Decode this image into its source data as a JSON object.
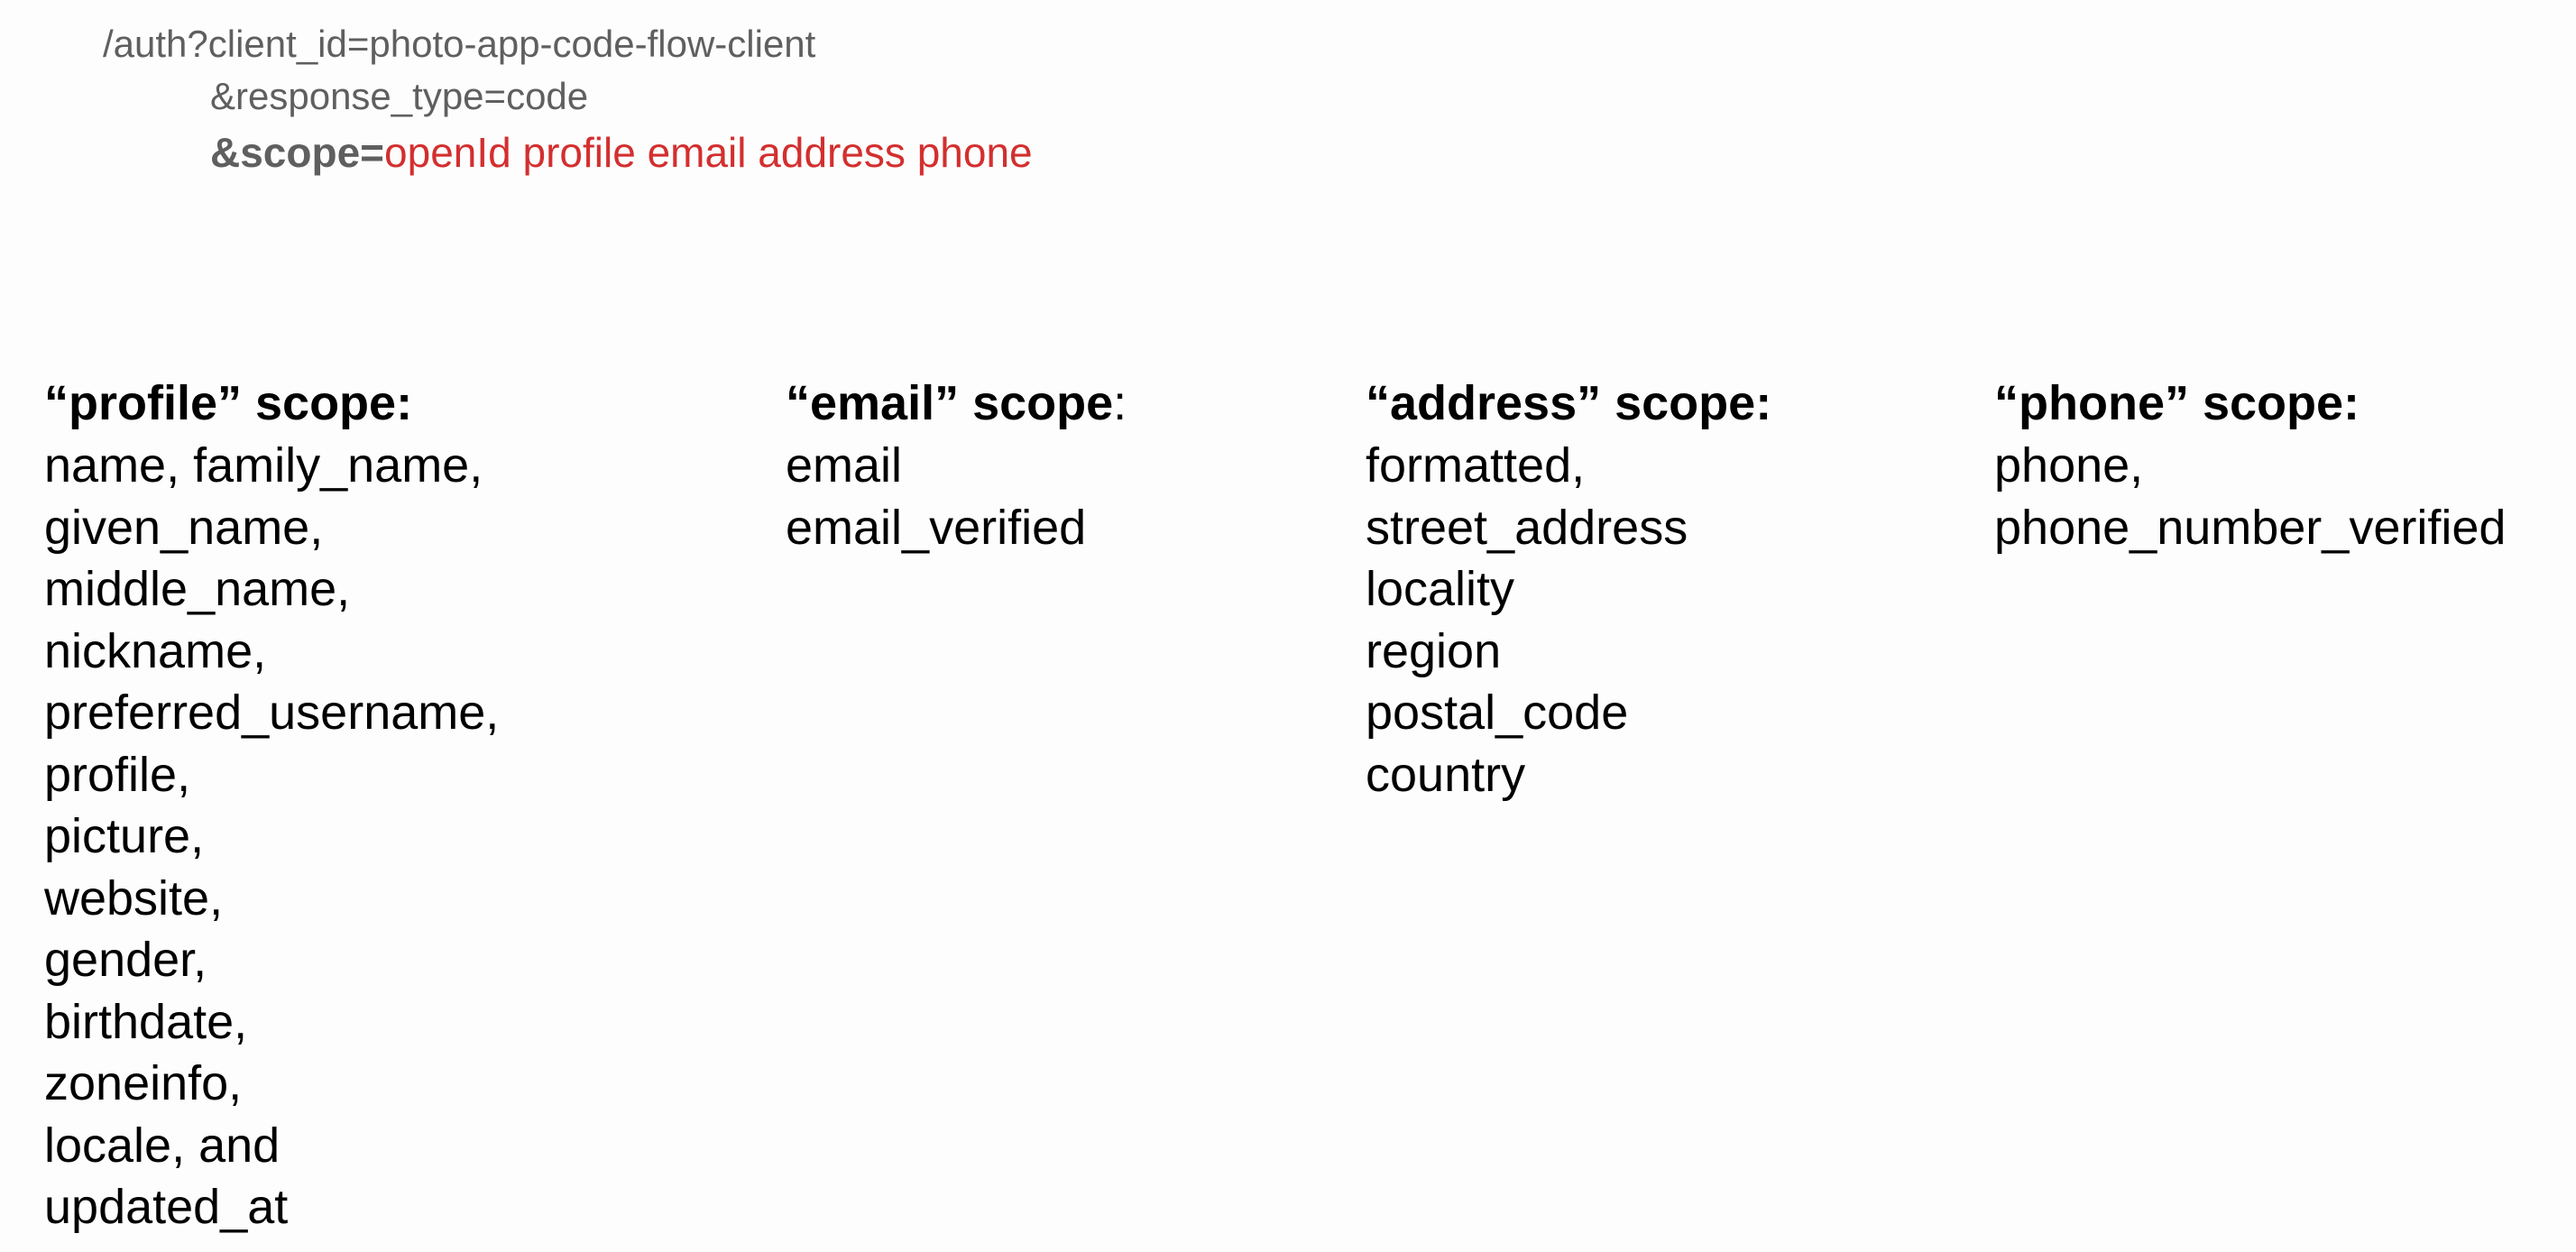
{
  "request": {
    "line1": "/auth?client_id=photo-app-code-flow-client",
    "line2": "&response_type=code",
    "scope_key": "&scope=",
    "scope_value": "openId profile email address phone"
  },
  "colors": {
    "url_text": "#5f5f5f",
    "scope_value": "#d32f2f",
    "body_text": "#000000",
    "background": "#fdfdfd"
  },
  "scopes": [
    {
      "heading": "“profile” scope",
      "colon": ":",
      "claims": [
        "name, family_name,",
        "given_name,",
        "middle_name,",
        "nickname,",
        "preferred_username,",
        "profile,",
        "picture,",
        "website,",
        "gender,",
        "birthdate,",
        "zoneinfo,",
        "locale, and",
        "updated_at"
      ]
    },
    {
      "heading": "“email” scope",
      "colon": ":",
      "claims": [
        "email",
        "email_verified"
      ]
    },
    {
      "heading": "“address” scope",
      "colon": ":",
      "claims": [
        "formatted,",
        "street_address",
        "locality",
        "region",
        "postal_code",
        "country"
      ]
    },
    {
      "heading": "“phone” scope",
      "colon": ":",
      "claims": [
        "phone,",
        "phone_number_verified"
      ]
    }
  ]
}
